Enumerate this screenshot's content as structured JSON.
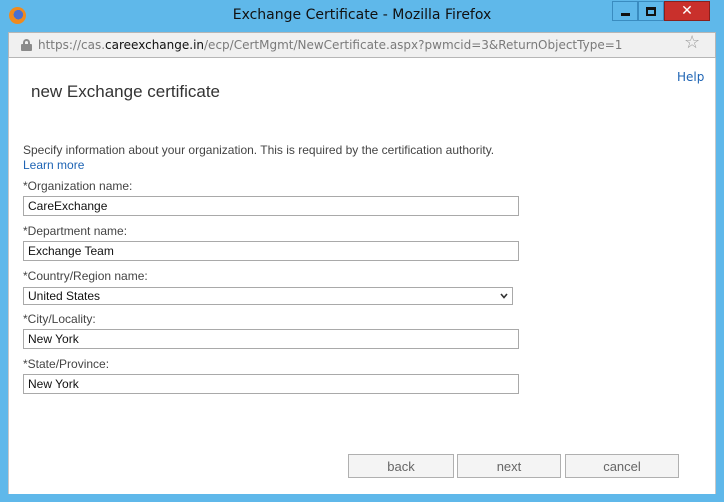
{
  "window": {
    "title": "Exchange Certificate - Mozilla Firefox"
  },
  "address_bar": {
    "url_prefix": "https://cas.",
    "url_domain": "careexchange.in",
    "url_path": "/ecp/CertMgmt/NewCertificate.aspx?pwmcid=3&ReturnObjectType=1"
  },
  "page": {
    "help_label": "Help",
    "title": "new Exchange certificate",
    "intro": "Specify information about your organization. This is required by the certification authority.",
    "learn_more": "Learn more"
  },
  "form": {
    "organization": {
      "label": "*Organization name:",
      "value": "CareExchange"
    },
    "department": {
      "label": "*Department name:",
      "value": "Exchange Team"
    },
    "country": {
      "label": "*Country/Region name:",
      "value": "United States"
    },
    "city": {
      "label": "*City/Locality:",
      "value": "New York"
    },
    "state": {
      "label": "*State/Province:",
      "value": "New York"
    }
  },
  "buttons": {
    "back": "back",
    "next": "next",
    "cancel": "cancel"
  },
  "colors": {
    "titlebar": "#5fb8ea",
    "link": "#1e64b4",
    "close_button": "#c9302c"
  }
}
